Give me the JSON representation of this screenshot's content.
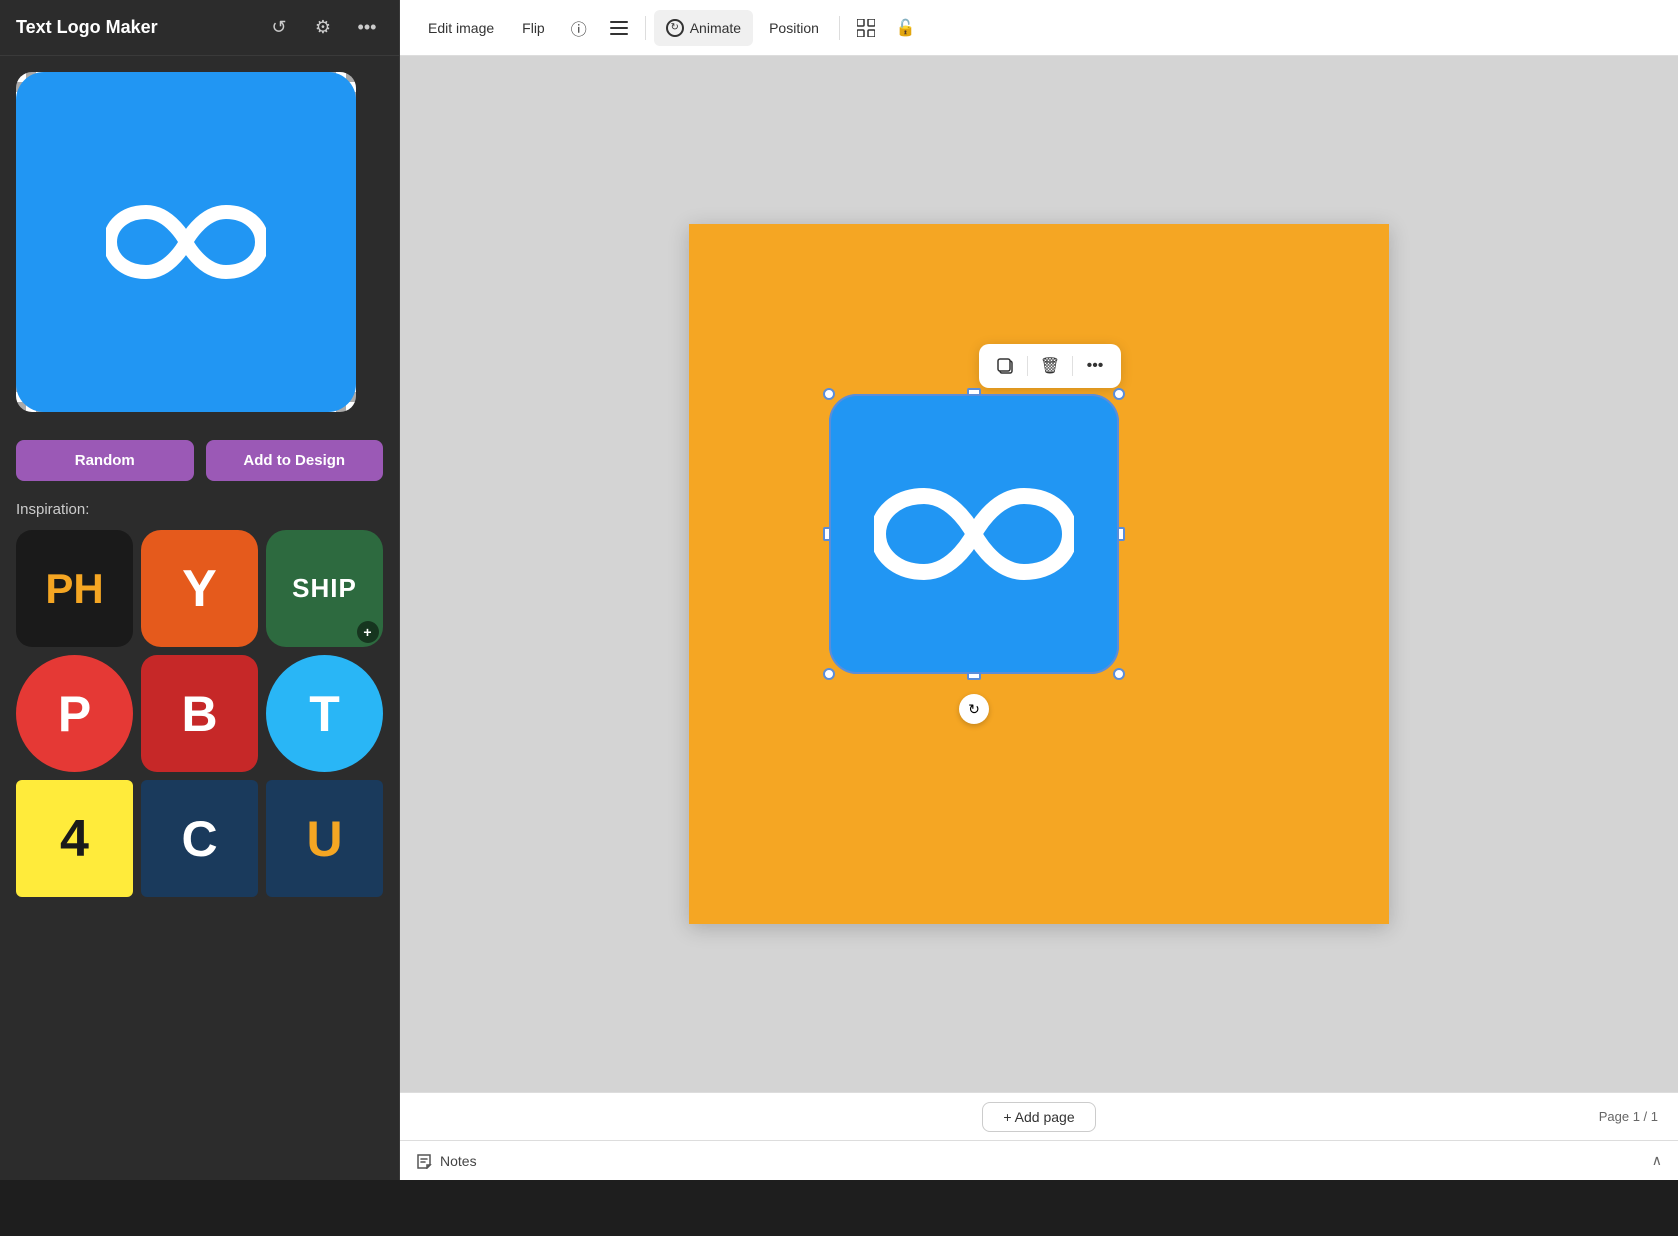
{
  "app": {
    "title": "Text Logo Maker"
  },
  "topbar": {
    "refresh_label": "↺",
    "settings_label": "⚙",
    "more_label": "···"
  },
  "toolbar": {
    "edit_image": "Edit image",
    "flip": "Flip",
    "info": "ⓘ",
    "lines": "≡",
    "animate": "Animate",
    "position": "Position",
    "grid_icon": "⊞",
    "lock_icon": "🔓"
  },
  "sidebar": {
    "preview_alt": "Blue infinity logo preview",
    "random_btn": "Random",
    "add_to_design_btn": "Add to Design",
    "inspiration_label": "Inspiration:"
  },
  "inspiration_items": [
    {
      "id": "ph",
      "text": "PH",
      "bg": "#1a1a1a",
      "color": "#f5a623",
      "shape": "rounded-rect",
      "hasPlus": false
    },
    {
      "id": "y",
      "text": "Y",
      "bg": "#e55a1c",
      "color": "#ffffff",
      "shape": "rounded-rect",
      "hasPlus": false
    },
    {
      "id": "ship",
      "text": "SHIP",
      "bg": "#2d6a3f",
      "color": "#ffffff",
      "shape": "rounded-rect",
      "hasPlus": true,
      "fontSize": "28px"
    },
    {
      "id": "p",
      "text": "P",
      "bg": "#e53935",
      "color": "#ffffff",
      "shape": "circle",
      "hasPlus": false
    },
    {
      "id": "b",
      "text": "B",
      "bg": "#c62828",
      "color": "#ffffff",
      "shape": "rounded-rect",
      "hasPlus": false
    },
    {
      "id": "t",
      "text": "T",
      "bg": "#29b6f6",
      "color": "#ffffff",
      "shape": "circle",
      "hasPlus": false
    },
    {
      "id": "4",
      "text": "4",
      "bg": "#ffeb3b",
      "color": "#1a1a1a",
      "shape": "square",
      "hasPlus": false
    },
    {
      "id": "c",
      "text": "C",
      "bg": "#1a3a5c",
      "color": "#ffffff",
      "shape": "square",
      "hasPlus": false
    },
    {
      "id": "u",
      "text": "U",
      "bg": "#1a3a5c",
      "color": "#f5a623",
      "shape": "square",
      "hasPlus": false
    }
  ],
  "context_toolbar": {
    "copy_icon": "⧉",
    "delete_icon": "🗑",
    "more_icon": "···"
  },
  "canvas": {
    "bg_color": "#f5a623"
  },
  "bottom": {
    "add_page": "+ Add page",
    "page_indicator": "Page 1 / 1"
  },
  "notes": {
    "label": "Notes",
    "chevron": "∧"
  }
}
